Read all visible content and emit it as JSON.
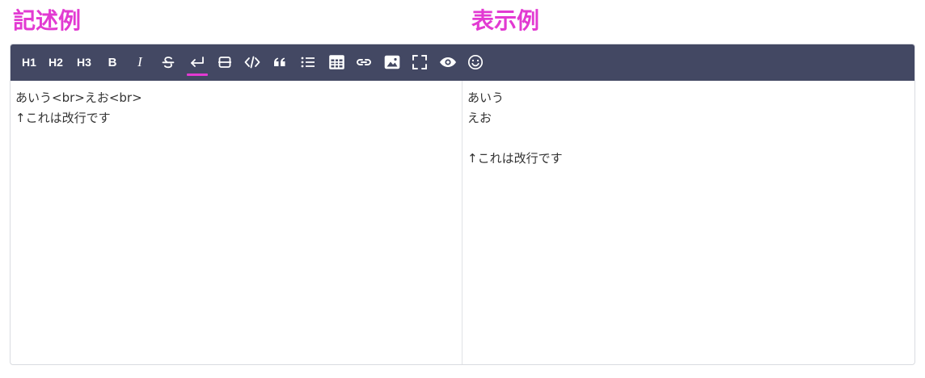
{
  "captions": {
    "left": "記述例",
    "right": "表示例",
    "color": "#e23ad2"
  },
  "toolbar": {
    "background": "#434863",
    "active_indicator_color": "#e23ad2",
    "buttons": [
      {
        "name": "h1-button",
        "label": "H1"
      },
      {
        "name": "h2-button",
        "label": "H2"
      },
      {
        "name": "h3-button",
        "label": "H3"
      },
      {
        "name": "bold-button",
        "label": "B"
      },
      {
        "name": "italic-button",
        "label": "I"
      },
      {
        "name": "strikethrough-button",
        "icon": "strikethrough-icon"
      },
      {
        "name": "line-break-button",
        "icon": "return-arrow-icon",
        "active": true
      },
      {
        "name": "horizontal-rule-button",
        "icon": "horizontal-rule-icon"
      },
      {
        "name": "code-button",
        "icon": "code-icon"
      },
      {
        "name": "quote-button",
        "icon": "quote-icon"
      },
      {
        "name": "list-button",
        "icon": "list-icon"
      },
      {
        "name": "table-button",
        "icon": "table-icon"
      },
      {
        "name": "link-button",
        "icon": "link-icon"
      },
      {
        "name": "image-button",
        "icon": "image-icon"
      },
      {
        "name": "fullscreen-button",
        "icon": "fullscreen-icon"
      },
      {
        "name": "preview-button",
        "icon": "eye-icon"
      },
      {
        "name": "emoji-button",
        "icon": "smiley-icon"
      }
    ]
  },
  "editor": {
    "lines": [
      "あいう<br>えお<br>",
      "↑これは改行です"
    ]
  },
  "preview": {
    "lines": [
      "あいう",
      "えお",
      "",
      "↑これは改行です"
    ]
  }
}
